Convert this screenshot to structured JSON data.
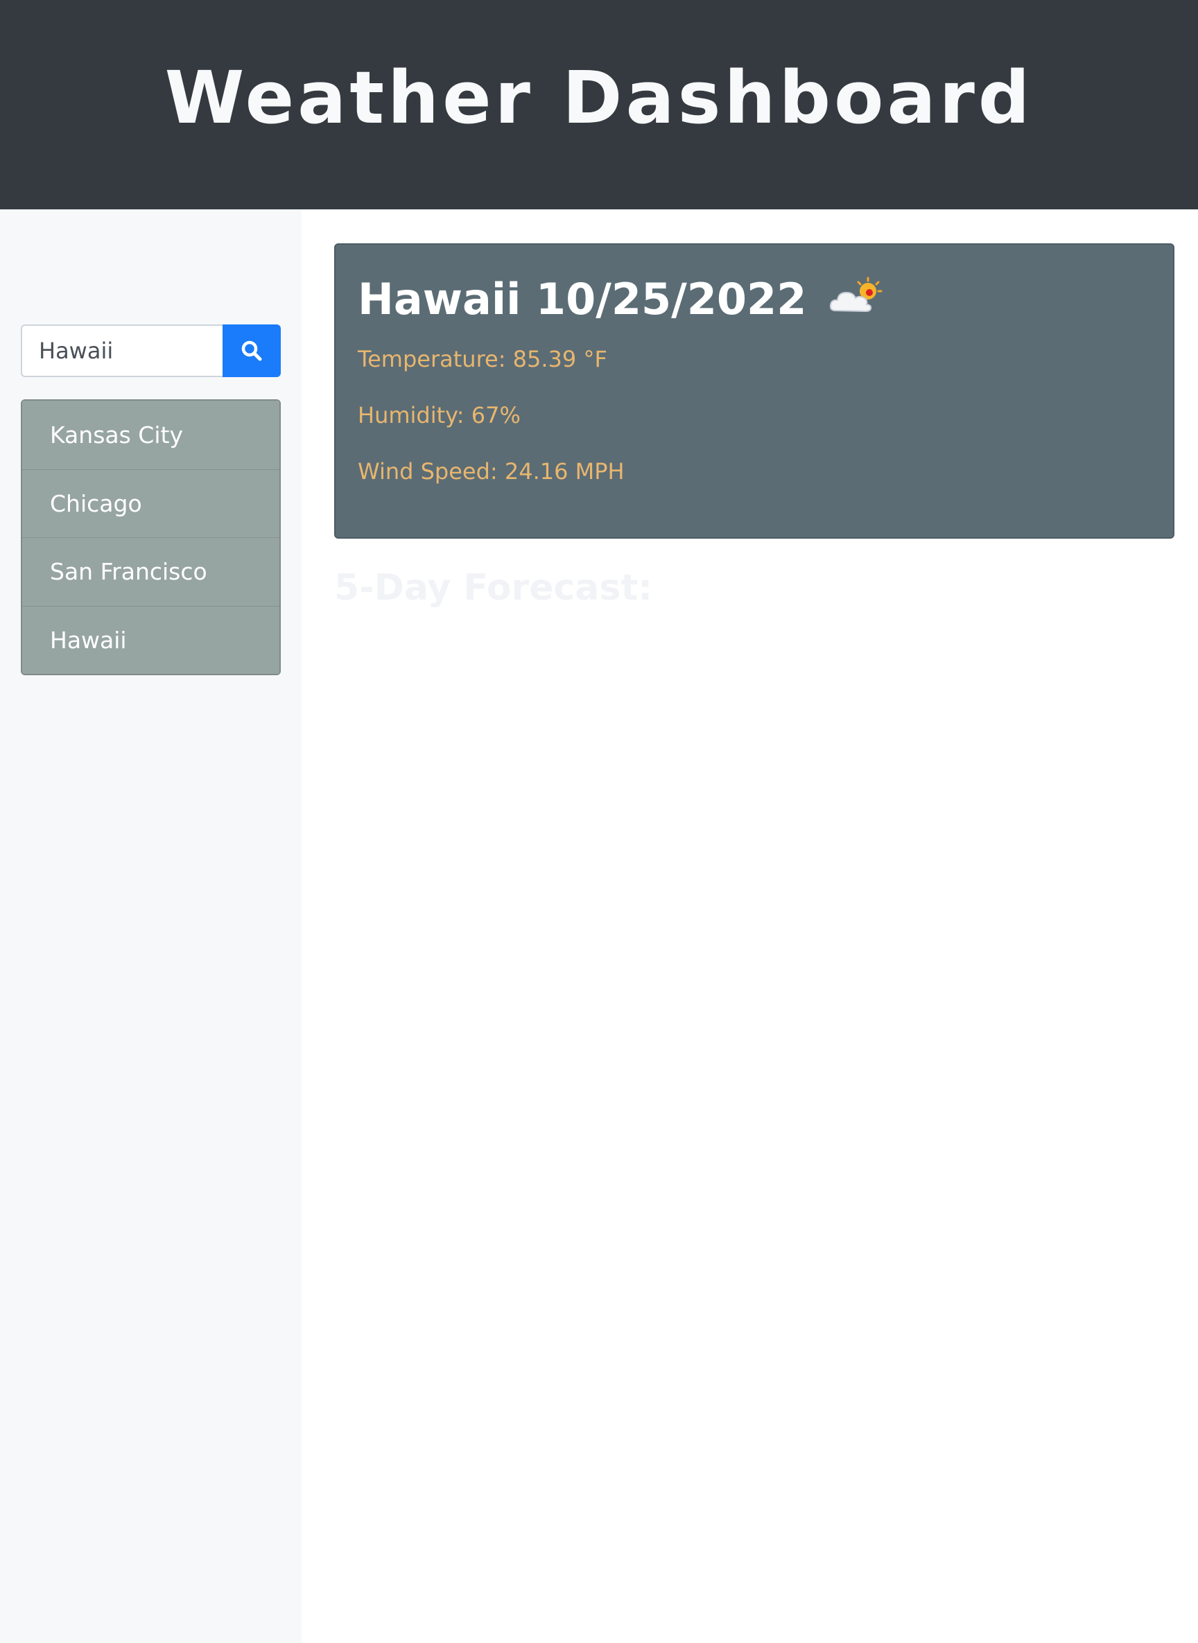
{
  "header": {
    "title": "Weather Dashboard"
  },
  "sidebar": {
    "search": {
      "value": "Hawaii",
      "button_icon": "search-icon",
      "button_color": "#1a7cfa"
    },
    "history": [
      {
        "label": "Kansas City"
      },
      {
        "label": "Chicago"
      },
      {
        "label": "San Francisco"
      },
      {
        "label": "Hawaii"
      }
    ]
  },
  "current": {
    "title": "Hawaii 10/25/2022",
    "icon": "partly-cloudy-icon",
    "temperature": "Temperature: 85.39 °F",
    "humidity": "Humidity: 67%",
    "wind": "Wind Speed: 24.16 MPH"
  },
  "forecast": {
    "title": "5-Day Forecast:"
  },
  "colors": {
    "header_bg": "#343a40",
    "card_bg": "#5b6c75",
    "stat_text": "#e8b66e",
    "history_bg": "#97a5a2",
    "sidebar_bg": "#f7f8fa"
  }
}
